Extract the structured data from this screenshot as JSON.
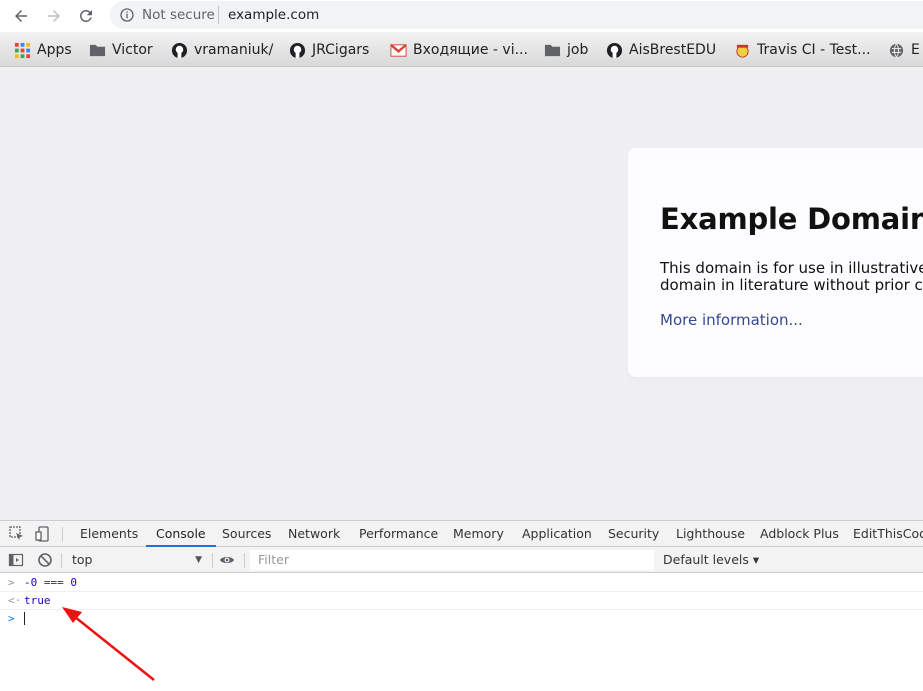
{
  "browser": {
    "security_label": "Not secure",
    "url": "example.com"
  },
  "bookmarks": [
    {
      "label": "Apps",
      "icon": "apps-grid-icon"
    },
    {
      "label": "Victor",
      "icon": "folder-icon"
    },
    {
      "label": "vramaniuk/",
      "icon": "github-icon"
    },
    {
      "label": "JRCigars",
      "icon": "github-icon"
    },
    {
      "label": "Входящие - vi...",
      "icon": "gmail-icon"
    },
    {
      "label": "job",
      "icon": "folder-icon"
    },
    {
      "label": "AisBrestEDU",
      "icon": "github-icon"
    },
    {
      "label": "Travis CI - Test...",
      "icon": "travis-icon"
    },
    {
      "label": "E",
      "icon": "globe-icon"
    }
  ],
  "page": {
    "heading": "Example Domain",
    "paragraph_line1": "This domain is for use in illustrative e",
    "paragraph_line2": "domain in literature without prior co",
    "link": "More information..."
  },
  "devtools": {
    "tabs": [
      "Elements",
      "Console",
      "Sources",
      "Network",
      "Performance",
      "Memory",
      "Application",
      "Security",
      "Lighthouse",
      "Adblock Plus",
      "EditThisCook"
    ],
    "active_tab": "Console",
    "context": "top",
    "filter_placeholder": "Filter",
    "levels_label": "Default levels ▾",
    "console": {
      "input_neg": "-0",
      "input_op": " === ",
      "input_zero": "0",
      "result": "true"
    }
  },
  "colors": {
    "accent": "#1a73e8",
    "link": "#38488f",
    "annotation_arrow": "#ee1111"
  }
}
